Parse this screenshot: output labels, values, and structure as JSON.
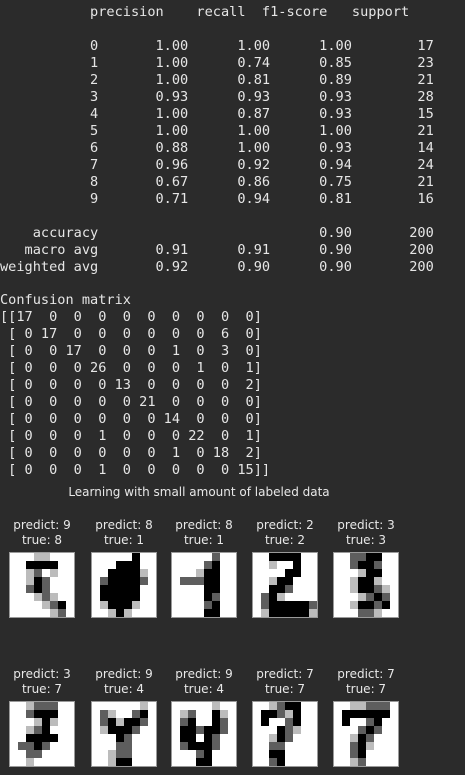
{
  "report": {
    "header": "           precision    recall  f1-score   support",
    "rows": [
      "",
      "           0       1.00      1.00      1.00        17",
      "           1       1.00      0.74      0.85        23",
      "           2       1.00      0.81      0.89        21",
      "           3       0.93      0.93      0.93        28",
      "           4       1.00      0.87      0.93        15",
      "           5       1.00      1.00      1.00        21",
      "           6       0.88      1.00      0.93        14",
      "           7       0.96      0.92      0.94        24",
      "           8       0.67      0.86      0.75        21",
      "           9       0.71      0.94      0.81        16",
      "",
      "    accuracy                           0.90       200",
      "   macro avg       0.91      0.91      0.90       200",
      "weighted avg       0.92      0.90      0.90       200"
    ]
  },
  "confusion": {
    "title": "Confusion matrix",
    "rows": [
      "[[17  0  0  0  0  0  0  0  0  0]",
      " [ 0 17  0  0  0  0  0  0  6  0]",
      " [ 0  0 17  0  0  0  1  0  3  0]",
      " [ 0  0  0 26  0  0  0  1  0  1]",
      " [ 0  0  0  0 13  0  0  0  0  2]",
      " [ 0  0  0  0  0 21  0  0  0  0]",
      " [ 0  0  0  0  0  0 14  0  0  0]",
      " [ 0  0  0  1  0  0  0 22  0  1]",
      " [ 0  0  0  0  0  0  1  0 18  2]",
      " [ 0  0  0  1  0  0  0  0  0 15]]"
    ]
  },
  "figure": {
    "title": "Learning with small amount of labeled data",
    "samples": [
      {
        "predict": "predict: 9",
        "true": "true: 8",
        "pixels": [
          "00011000",
          "00333300",
          "00120100",
          "00132000",
          "00232000",
          "00012100",
          "00001230",
          "00000120"
        ]
      },
      {
        "predict": "predict: 8",
        "true": "true: 1",
        "pixels": [
          "00000300",
          "00033300",
          "00333310",
          "02333320",
          "03333300",
          "03333300",
          "01333100",
          "00131000"
        ]
      },
      {
        "predict": "predict: 8",
        "true": "true: 1",
        "pixels": [
          "00000200",
          "00002300",
          "00013300",
          "02223300",
          "00003300",
          "00003200",
          "00002300",
          "00003300"
        ]
      },
      {
        "predict": "predict: 2",
        "true": "true: 2",
        "pixels": [
          "00333300",
          "00100300",
          "00003300",
          "00133000",
          "00332000",
          "02310000",
          "02333332",
          "01333331"
        ]
      },
      {
        "predict": "predict: 3",
        "true": "true: 3",
        "pixels": [
          "00223300",
          "00233200",
          "00013300",
          "00133100",
          "00133210",
          "00012320",
          "00133230",
          "00022100"
        ]
      },
      {
        "predict": "predict: 3",
        "true": "true: 7",
        "pixels": [
          "00122200",
          "00233300",
          "00013100",
          "00123000",
          "00333300",
          "02232000",
          "00220000",
          "00100000"
        ]
      },
      {
        "predict": "predict: 9",
        "true": "true: 4",
        "pixels": [
          "00000010",
          "02100230",
          "02313320",
          "01333200",
          "00032000",
          "00022000",
          "00122000",
          "00133000"
        ]
      },
      {
        "predict": "predict: 9",
        "true": "true: 4",
        "pixels": [
          "00000100",
          "01200310",
          "02300320",
          "03323320",
          "03303200",
          "02333200",
          "00023000",
          "00033000"
        ]
      },
      {
        "predict": "predict: 7",
        "true": "true: 7",
        "pixels": [
          "00123300",
          "03321300",
          "03002300",
          "00032100",
          "00132000",
          "00220000",
          "00330000",
          "00230000"
        ]
      },
      {
        "predict": "predict: 7",
        "true": "true: 7",
        "pixels": [
          "00112220",
          "03333330",
          "03002300",
          "00023200",
          "00132000",
          "00231000",
          "00230000",
          "00120000"
        ]
      }
    ]
  },
  "colors": {
    "background": "#2b2b2b",
    "text": "#e6e6e6",
    "ink": [
      "#ffffff",
      "#bcbcbc",
      "#5e5e5e",
      "#000000"
    ]
  }
}
